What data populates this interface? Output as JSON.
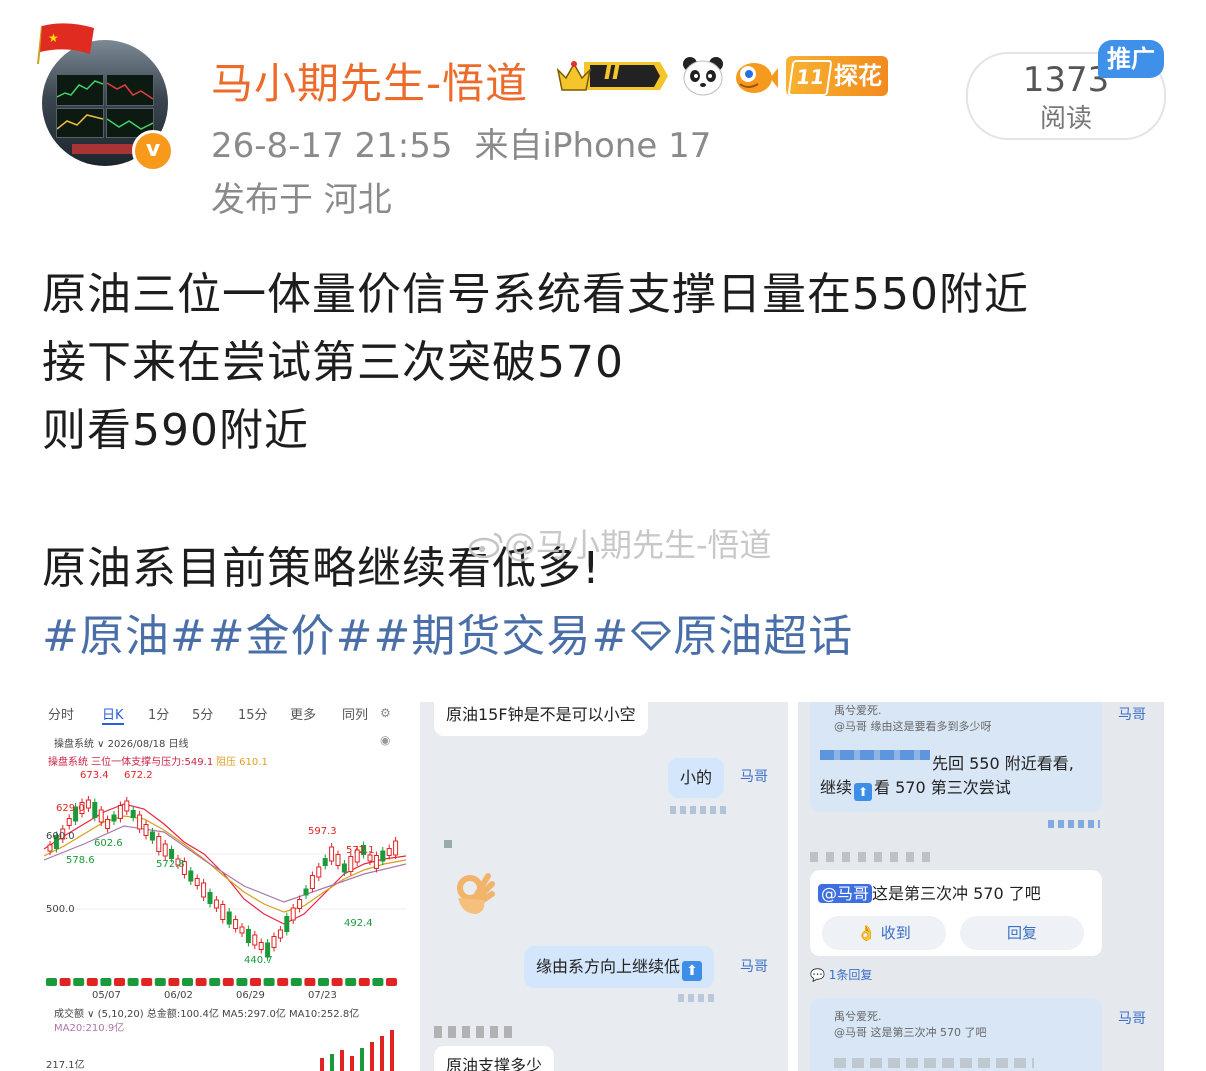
{
  "post": {
    "username": "马小期先生-悟道",
    "timestamp": "26-8-17 21:55",
    "source": "来自iPhone 17",
    "location": "发布于 河北",
    "read_count": "1373",
    "read_label": "阅读",
    "promo_label": "推广",
    "badges": {
      "level": "II",
      "tanhua_level": "11",
      "tanhua_label": "探花"
    },
    "text_lines": [
      "原油三位一体量价信号系统看支撑日量在550附近",
      "接下来在尝试第三次突破570",
      "则看590附近",
      "原油系目前策略继续看低多!"
    ],
    "tags": {
      "tag1": "#原油#",
      "tag2": "#金价#",
      "tag3": "#期货交易#",
      "tag4": "原油超话"
    },
    "watermark": "@马小期先生-悟道"
  },
  "image1": {
    "tabs": [
      "分时",
      "日K",
      "1分",
      "5分",
      "15分",
      "更多",
      "同列"
    ],
    "info_line": "操盘系统 ∨  2026/08/18  日线",
    "indicator_line": "操盘系统  三位一体支撑与压力:549.1",
    "indicator_extra": "阻压 610.1",
    "price_labels": [
      "673.4",
      "672.2",
      "629.0",
      "600.0",
      "602.6",
      "578.6",
      "572.8",
      "597.3",
      "572.1",
      "500.0",
      "492.4",
      "440.7"
    ],
    "dates": [
      "05/07",
      "06/02",
      "06/29",
      "07/23"
    ],
    "volume_line": "成交额 ∨ (5,10,20)  总金额:100.4亿  MA5:297.0亿  MA10:252.8亿",
    "ma20": "MA20:210.9亿",
    "volume_max": "217.1亿"
  },
  "image2": {
    "messages": [
      {
        "text": "原油15F钟是不是可以小空",
        "side": "left"
      },
      {
        "text": "小的",
        "side": "right",
        "sender": "马哥"
      },
      {
        "text": "缘由系方向上继续低",
        "side": "right",
        "sender": "马哥"
      },
      {
        "text": "原油支撑多少",
        "side": "left"
      }
    ]
  },
  "image3": {
    "top_sender": "马哥",
    "quote_name": "禹兮爱死.",
    "quote_text": "@马哥 缘由这是要看多到多少呀",
    "reply_text_1": "先回 550 附近看看,",
    "reply_text_2": "继续",
    "reply_text_3": "看 570 第三次尝试",
    "mention": "@马哥",
    "question": "这是第三次冲 570 了吧",
    "received_label": "收到",
    "reply_label": "回复",
    "reply_count": "1条回复",
    "quote_name_2": "禹兮爱死.",
    "quote_text_2": "@马哥 这是第三次冲 570 了吧",
    "sender_2": "马哥"
  },
  "colors": {
    "username": "#ec6b2a",
    "meta": "#8a8a8a",
    "tag": "#4a6fa8",
    "promo": "#3e90e8",
    "bullish": "#e02424",
    "bearish": "#1a9a3a"
  }
}
